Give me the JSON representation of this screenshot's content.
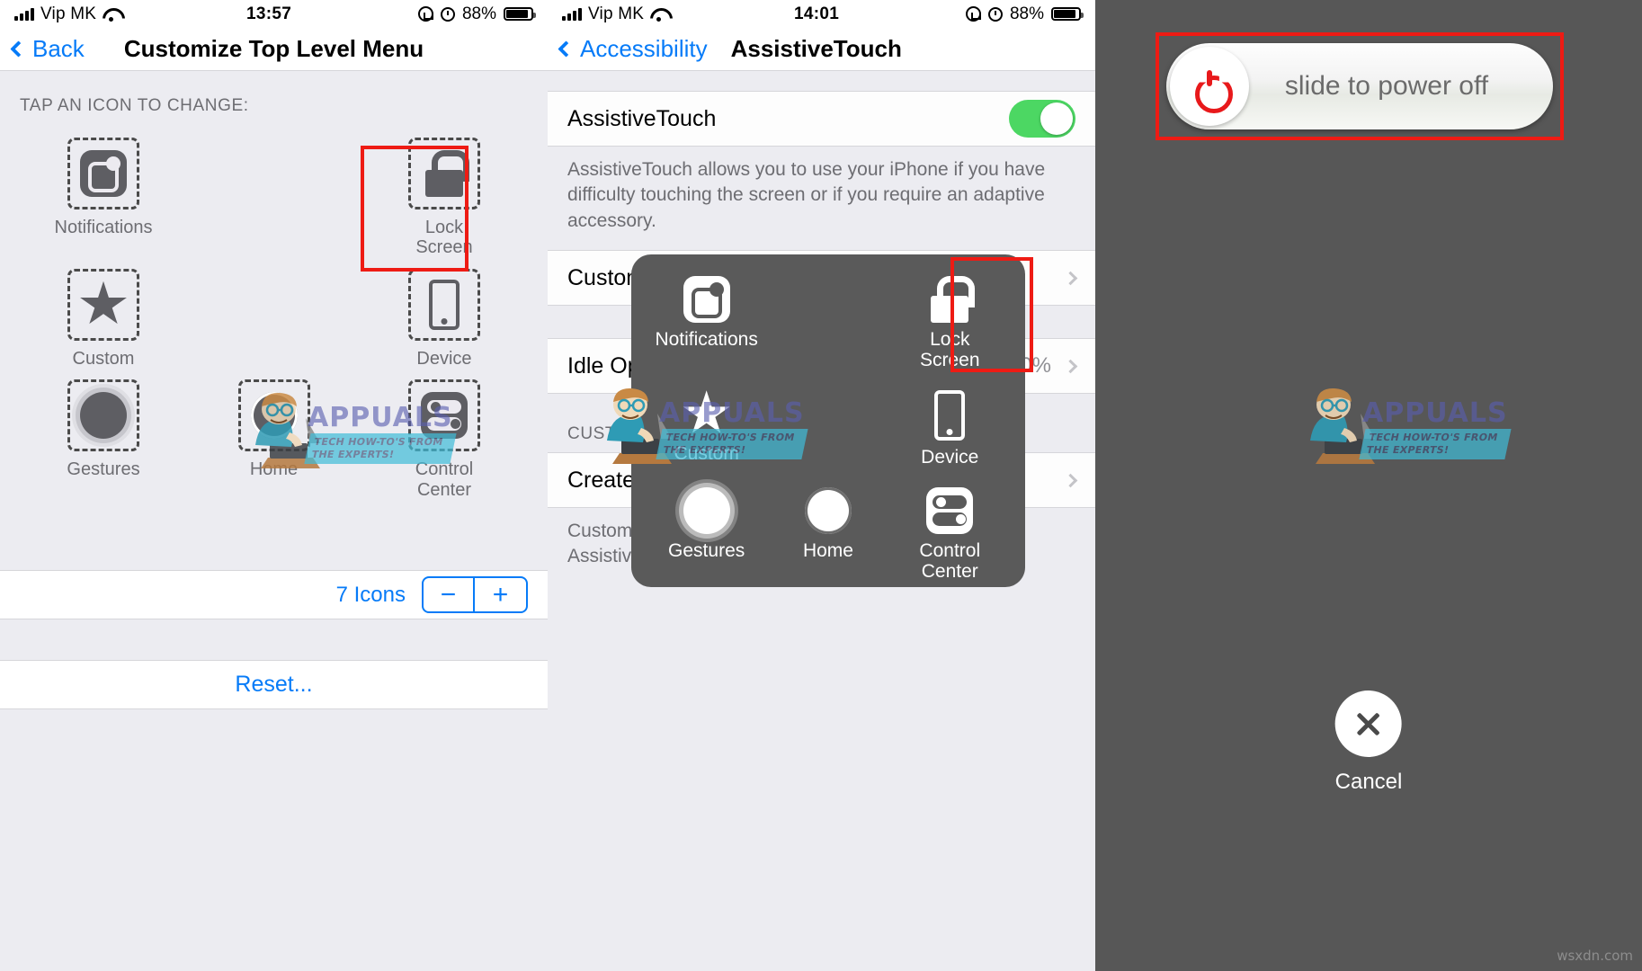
{
  "panels": {
    "left": {
      "status": {
        "carrier": "Vip MK",
        "time": "13:57",
        "battery": "88%"
      },
      "nav": {
        "back_label": "Back",
        "title": "Customize Top Level Menu"
      },
      "section_header": "TAP AN ICON TO CHANGE:",
      "icons": [
        {
          "label": "Notifications",
          "glyph": "notifications-icon",
          "highlighted": false
        },
        {
          "label": "",
          "glyph": "empty-slot",
          "highlighted": false
        },
        {
          "label": "Lock\nScreen",
          "glyph": "lock-icon",
          "highlighted": true
        },
        {
          "label": "Custom",
          "glyph": "star-icon",
          "highlighted": false
        },
        {
          "label": "",
          "glyph": "empty-slot",
          "highlighted": false
        },
        {
          "label": "Device",
          "glyph": "device-icon",
          "highlighted": false
        },
        {
          "label": "Gestures",
          "glyph": "gestures-icon",
          "highlighted": false
        },
        {
          "label": "Home",
          "glyph": "home-icon",
          "highlighted": false
        },
        {
          "label": "Control\nCenter",
          "glyph": "control-center-icon",
          "highlighted": false
        }
      ],
      "count_label": "7 Icons",
      "stepper": {
        "minus": "−",
        "plus": "+"
      },
      "reset_label": "Reset..."
    },
    "mid": {
      "status": {
        "carrier": "Vip MK",
        "time": "14:01",
        "battery": "88%"
      },
      "nav": {
        "back_label": "Accessibility",
        "title": "AssistiveTouch"
      },
      "toggle_row": {
        "label": "AssistiveTouch",
        "state": "on"
      },
      "footnote": "AssistiveTouch allows you to use your iPhone if you have difficulty touching the screen or if you require an adaptive accessory.",
      "rows": [
        {
          "label": "Customize Top Level Menu",
          "value": ""
        },
        {
          "label": "Idle Opacity",
          "value": "0%"
        }
      ],
      "group_header": "CUSTOM ACTIONS",
      "rows2": [
        {
          "label": "Create New Gesture...",
          "value": ""
        }
      ],
      "footnote2": "Custom gestures you create can be activated from the AssistiveTouch menu.",
      "overlay_icons": [
        {
          "label": "Notifications",
          "glyph": "notifications-icon",
          "highlighted": false
        },
        {
          "label": "",
          "glyph": "empty-slot",
          "highlighted": false
        },
        {
          "label": "Lock\nScreen",
          "glyph": "lock-icon",
          "highlighted": true
        },
        {
          "label": "Custom",
          "glyph": "star-icon",
          "highlighted": false
        },
        {
          "label": "",
          "glyph": "empty-slot",
          "highlighted": false
        },
        {
          "label": "Device",
          "glyph": "device-icon",
          "highlighted": false
        },
        {
          "label": "Gestures",
          "glyph": "gestures-icon",
          "highlighted": false
        },
        {
          "label": "Home",
          "glyph": "home-icon",
          "highlighted": false
        },
        {
          "label": "Control\nCenter",
          "glyph": "control-center-icon",
          "highlighted": false
        }
      ]
    },
    "right": {
      "slider_label": "slide to power off",
      "cancel_label": "Cancel"
    }
  },
  "watermark": {
    "brand": "APPUALS",
    "tagline_1": "TECH HOW-TO'S FROM",
    "tagline_2": "THE EXPERTS!",
    "site": "wsxdn.com"
  },
  "colors": {
    "accent_blue": "#067bf8",
    "highlight_red": "#ee1b14",
    "toggle_green": "#4cd763",
    "power_red": "#e8191b",
    "panel_bg": "#ececf1",
    "overlay_gray": "#5a5a5a"
  }
}
